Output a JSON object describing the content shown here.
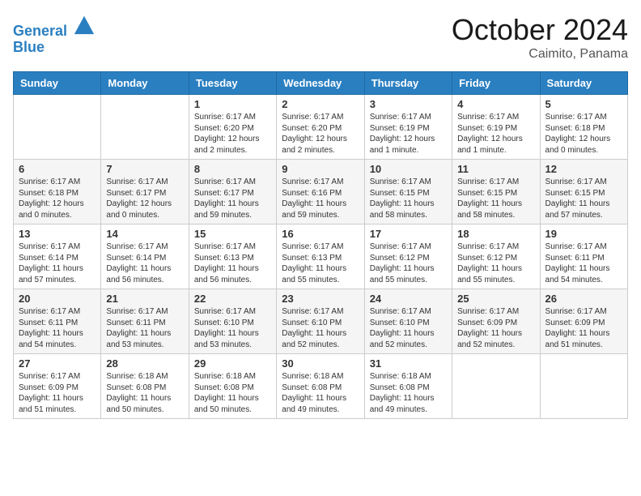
{
  "header": {
    "logo_line1": "General",
    "logo_line2": "Blue",
    "month": "October 2024",
    "location": "Caimito, Panama"
  },
  "weekdays": [
    "Sunday",
    "Monday",
    "Tuesday",
    "Wednesday",
    "Thursday",
    "Friday",
    "Saturday"
  ],
  "weeks": [
    [
      null,
      null,
      {
        "day": 1,
        "sunrise": "6:17 AM",
        "sunset": "6:20 PM",
        "daylight": "12 hours and 2 minutes."
      },
      {
        "day": 2,
        "sunrise": "6:17 AM",
        "sunset": "6:20 PM",
        "daylight": "12 hours and 2 minutes."
      },
      {
        "day": 3,
        "sunrise": "6:17 AM",
        "sunset": "6:19 PM",
        "daylight": "12 hours and 1 minute."
      },
      {
        "day": 4,
        "sunrise": "6:17 AM",
        "sunset": "6:19 PM",
        "daylight": "12 hours and 1 minute."
      },
      {
        "day": 5,
        "sunrise": "6:17 AM",
        "sunset": "6:18 PM",
        "daylight": "12 hours and 0 minutes."
      }
    ],
    [
      {
        "day": 6,
        "sunrise": "6:17 AM",
        "sunset": "6:18 PM",
        "daylight": "12 hours and 0 minutes."
      },
      {
        "day": 7,
        "sunrise": "6:17 AM",
        "sunset": "6:17 PM",
        "daylight": "12 hours and 0 minutes."
      },
      {
        "day": 8,
        "sunrise": "6:17 AM",
        "sunset": "6:17 PM",
        "daylight": "11 hours and 59 minutes."
      },
      {
        "day": 9,
        "sunrise": "6:17 AM",
        "sunset": "6:16 PM",
        "daylight": "11 hours and 59 minutes."
      },
      {
        "day": 10,
        "sunrise": "6:17 AM",
        "sunset": "6:15 PM",
        "daylight": "11 hours and 58 minutes."
      },
      {
        "day": 11,
        "sunrise": "6:17 AM",
        "sunset": "6:15 PM",
        "daylight": "11 hours and 58 minutes."
      },
      {
        "day": 12,
        "sunrise": "6:17 AM",
        "sunset": "6:15 PM",
        "daylight": "11 hours and 57 minutes."
      }
    ],
    [
      {
        "day": 13,
        "sunrise": "6:17 AM",
        "sunset": "6:14 PM",
        "daylight": "11 hours and 57 minutes."
      },
      {
        "day": 14,
        "sunrise": "6:17 AM",
        "sunset": "6:14 PM",
        "daylight": "11 hours and 56 minutes."
      },
      {
        "day": 15,
        "sunrise": "6:17 AM",
        "sunset": "6:13 PM",
        "daylight": "11 hours and 56 minutes."
      },
      {
        "day": 16,
        "sunrise": "6:17 AM",
        "sunset": "6:13 PM",
        "daylight": "11 hours and 55 minutes."
      },
      {
        "day": 17,
        "sunrise": "6:17 AM",
        "sunset": "6:12 PM",
        "daylight": "11 hours and 55 minutes."
      },
      {
        "day": 18,
        "sunrise": "6:17 AM",
        "sunset": "6:12 PM",
        "daylight": "11 hours and 55 minutes."
      },
      {
        "day": 19,
        "sunrise": "6:17 AM",
        "sunset": "6:11 PM",
        "daylight": "11 hours and 54 minutes."
      }
    ],
    [
      {
        "day": 20,
        "sunrise": "6:17 AM",
        "sunset": "6:11 PM",
        "daylight": "11 hours and 54 minutes."
      },
      {
        "day": 21,
        "sunrise": "6:17 AM",
        "sunset": "6:11 PM",
        "daylight": "11 hours and 53 minutes."
      },
      {
        "day": 22,
        "sunrise": "6:17 AM",
        "sunset": "6:10 PM",
        "daylight": "11 hours and 53 minutes."
      },
      {
        "day": 23,
        "sunrise": "6:17 AM",
        "sunset": "6:10 PM",
        "daylight": "11 hours and 52 minutes."
      },
      {
        "day": 24,
        "sunrise": "6:17 AM",
        "sunset": "6:10 PM",
        "daylight": "11 hours and 52 minutes."
      },
      {
        "day": 25,
        "sunrise": "6:17 AM",
        "sunset": "6:09 PM",
        "daylight": "11 hours and 52 minutes."
      },
      {
        "day": 26,
        "sunrise": "6:17 AM",
        "sunset": "6:09 PM",
        "daylight": "11 hours and 51 minutes."
      }
    ],
    [
      {
        "day": 27,
        "sunrise": "6:17 AM",
        "sunset": "6:09 PM",
        "daylight": "11 hours and 51 minutes."
      },
      {
        "day": 28,
        "sunrise": "6:18 AM",
        "sunset": "6:08 PM",
        "daylight": "11 hours and 50 minutes."
      },
      {
        "day": 29,
        "sunrise": "6:18 AM",
        "sunset": "6:08 PM",
        "daylight": "11 hours and 50 minutes."
      },
      {
        "day": 30,
        "sunrise": "6:18 AM",
        "sunset": "6:08 PM",
        "daylight": "11 hours and 49 minutes."
      },
      {
        "day": 31,
        "sunrise": "6:18 AM",
        "sunset": "6:08 PM",
        "daylight": "11 hours and 49 minutes."
      },
      null,
      null
    ]
  ]
}
